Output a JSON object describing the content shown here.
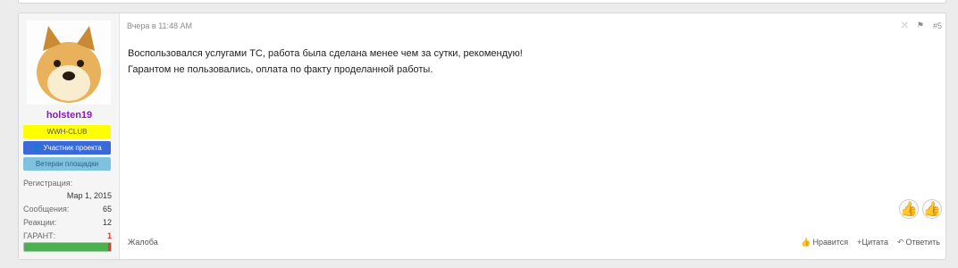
{
  "user": {
    "name": "holsten19",
    "badges": [
      "WWH-CLUB",
      "Участник проекта",
      "Ветеран площадки"
    ],
    "stats": [
      {
        "label": "Регистрация:",
        "value": ""
      },
      {
        "label": "",
        "value": "Мар 1, 2015"
      },
      {
        "label": "Сообщения:",
        "value": "65"
      },
      {
        "label": "Реакции:",
        "value": "12"
      },
      {
        "label": "ГАРАНТ:",
        "value": "1"
      }
    ],
    "garant_color": "#e23a3a",
    "rating_fill": 0.97
  },
  "post": {
    "date": "Вчера в 11:48 AM",
    "number": "#5",
    "lines": [
      "Воспользовался услугами ТС, работа была сделана менее чем за сутки, рекомендую!",
      "Гарантом не пользовались, оплата по факту проделанной работы."
    ]
  },
  "footer": {
    "report": "Жалоба",
    "like": "Нравится",
    "quote": "+Цитата",
    "reply": "Ответить"
  },
  "icons": [
    "share-icon",
    "bookmark-icon",
    "thumbs-up-icon",
    "thumbs-up-filled-icon",
    "like-icon",
    "reply-icon"
  ]
}
